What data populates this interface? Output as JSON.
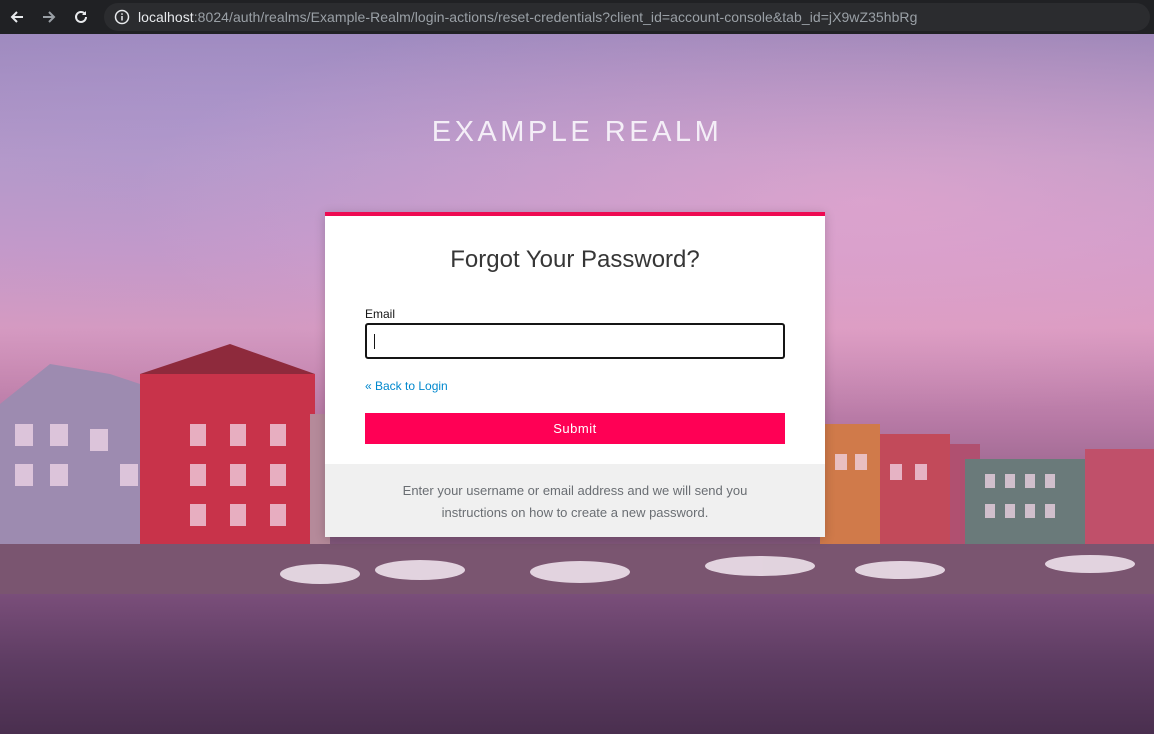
{
  "browser": {
    "url_host": "localhost",
    "url_rest": ":8024/auth/realms/Example-Realm/login-actions/reset-credentials?client_id=account-console&tab_id=jX9wZ35hbRg"
  },
  "realm": {
    "title": "EXAMPLE REALM"
  },
  "form": {
    "title": "Forgot Your Password?",
    "email_label": "Email",
    "email_value": "",
    "back_link": "« Back to Login",
    "submit_label": "Submit",
    "info_text": "Enter your username or email address and we will send you instructions on how to create a new password."
  },
  "colors": {
    "accent": "#ee0a52",
    "button": "#ff0055",
    "link": "#0088ce"
  }
}
